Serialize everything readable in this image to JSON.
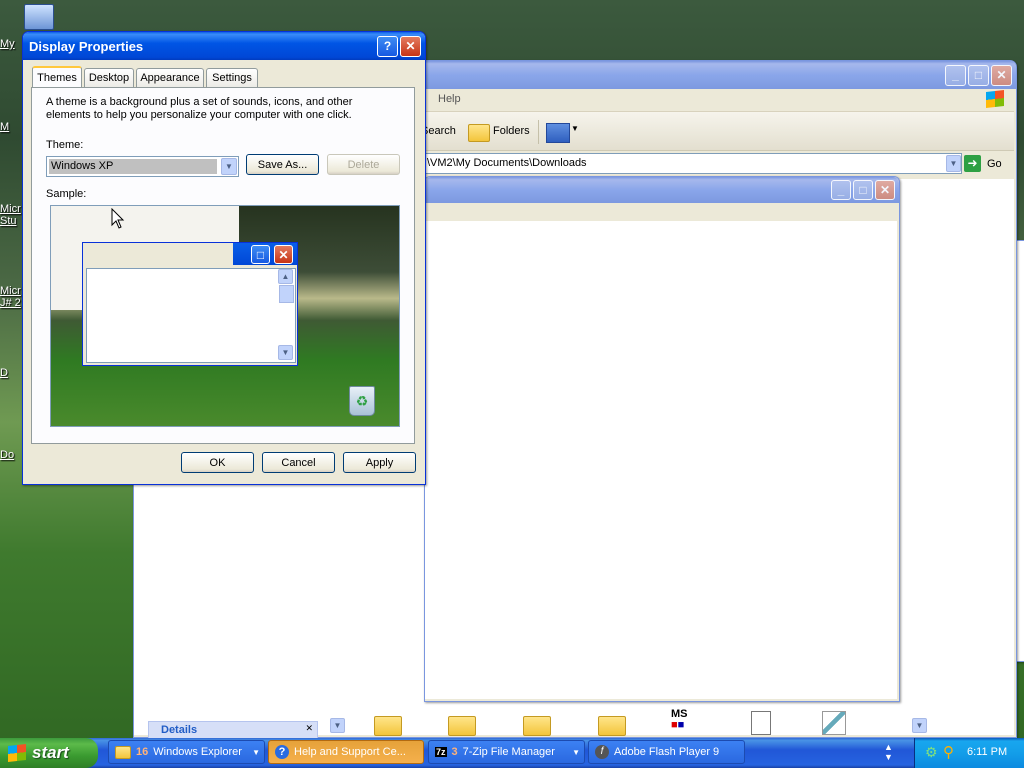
{
  "desktop": {
    "icons": [
      {
        "label": "My"
      },
      {
        "label": "M"
      },
      {
        "label": "Micr"
      },
      {
        "label": "Stu"
      },
      {
        "label": "Micr"
      },
      {
        "label": "J# 2"
      },
      {
        "label": "D"
      },
      {
        "label": "Do"
      }
    ]
  },
  "explorer": {
    "menu_help": "Help",
    "toolbar_search": "Search",
    "toolbar_folders": "Folders",
    "address": "\\VM2\\My Documents\\Downloads",
    "go": "Go",
    "details": "Details"
  },
  "dialog": {
    "title": "Display Properties",
    "tabs": [
      "Themes",
      "Desktop",
      "Appearance",
      "Settings"
    ],
    "description": "A theme is a background plus a set of sounds, icons, and other elements to help you personalize your computer with one click.",
    "theme_label": "Theme:",
    "theme_value": "Windows XP",
    "save_as": "Save As...",
    "delete": "Delete",
    "sample_label": "Sample:",
    "ok": "OK",
    "cancel": "Cancel",
    "apply": "Apply"
  },
  "taskbar": {
    "start": "start",
    "items": [
      {
        "count": "16",
        "label": "Windows Explorer"
      },
      {
        "label": "Help and Support Ce..."
      },
      {
        "count": "3",
        "label": "7-Zip File Manager"
      },
      {
        "label": "Adobe Flash Player 9"
      }
    ],
    "clock": "6:11 PM"
  },
  "colors": {
    "taskbar": "#245edb",
    "start": "#3c9a3c",
    "title_active": "#0055e5",
    "dialog_bg": "#ece9d8"
  }
}
